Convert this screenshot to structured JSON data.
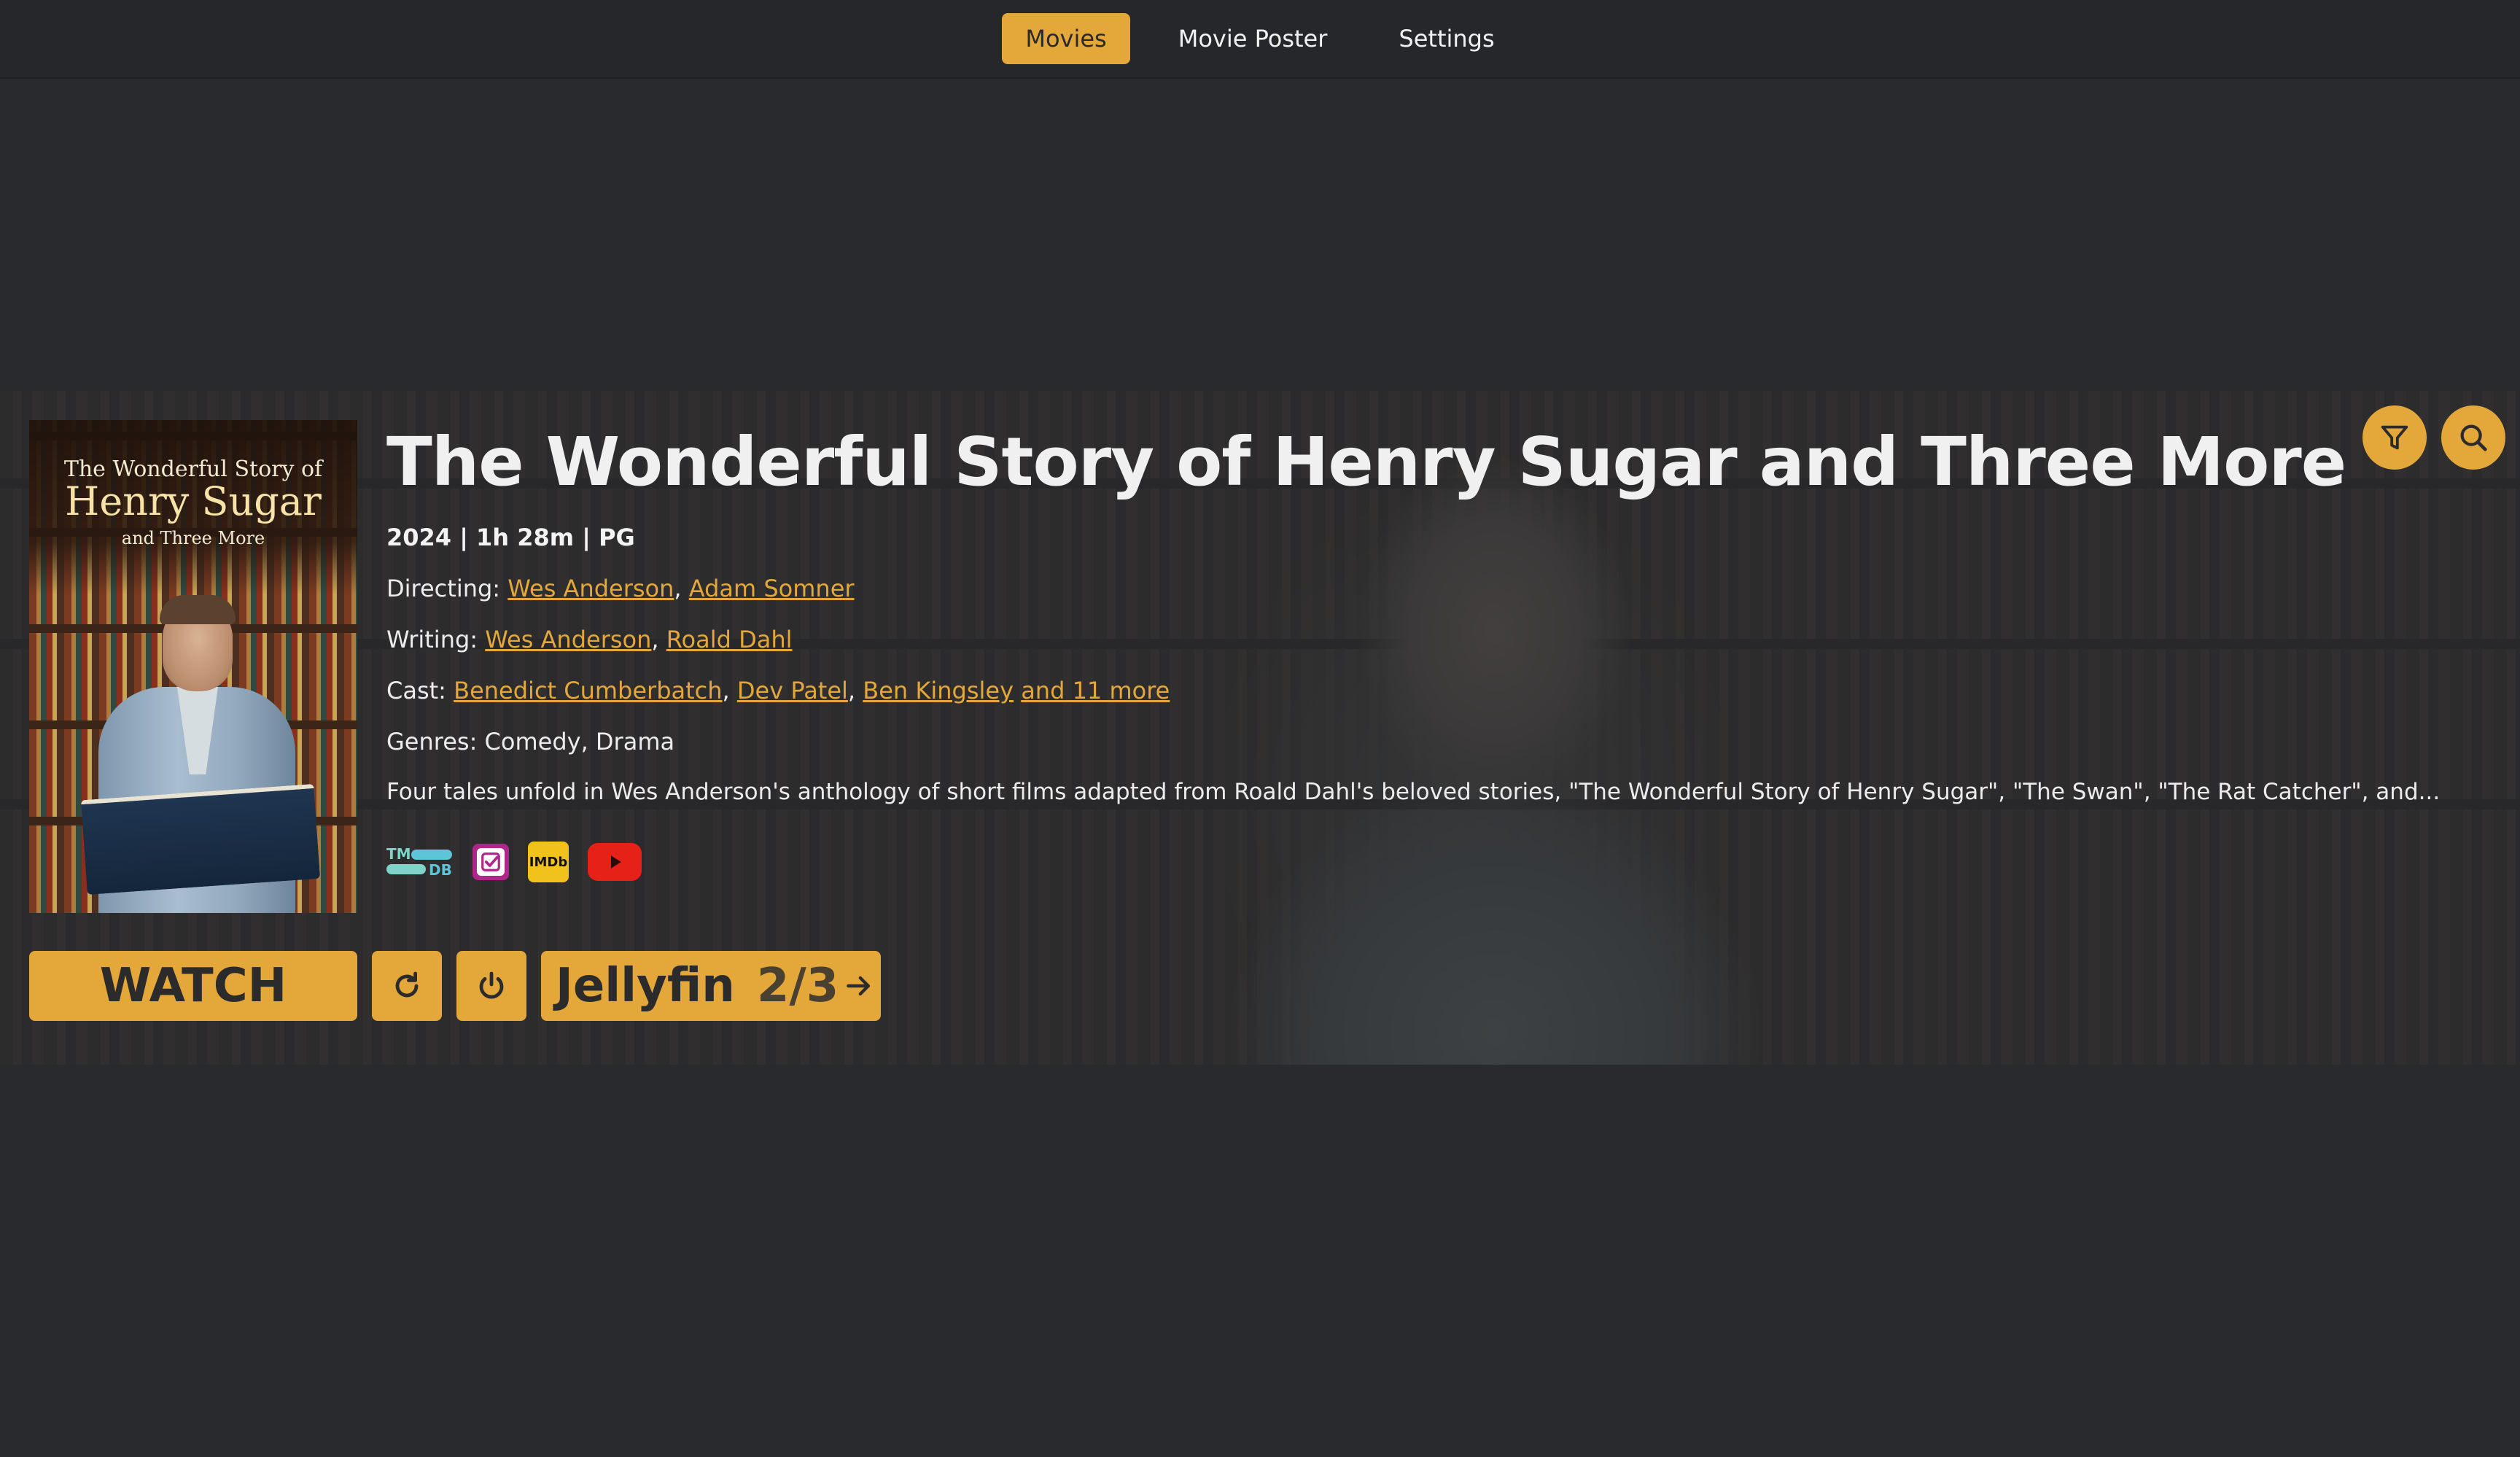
{
  "nav": {
    "tabs": [
      {
        "label": "Movies",
        "active": true
      },
      {
        "label": "Movie Poster",
        "active": false
      },
      {
        "label": "Settings",
        "active": false
      }
    ]
  },
  "poster": {
    "line1": "The Wonderful Story of",
    "line2": "Henry Sugar",
    "line3": "and Three More"
  },
  "movie": {
    "title": "The Wonderful Story of Henry Sugar and Three More",
    "meta": "2024 | 1h 28m | PG",
    "directing_label": "Directing:",
    "directors": [
      "Wes Anderson",
      "Adam Somner"
    ],
    "writing_label": "Writing:",
    "writers": [
      "Wes Anderson",
      "Roald Dahl"
    ],
    "cast_label": "Cast:",
    "cast": [
      "Benedict Cumberbatch",
      "Dev Patel",
      "Ben Kingsley"
    ],
    "cast_more": "and 11 more",
    "genres_label": "Genres:",
    "genres": "Comedy, Drama",
    "overview": "Four tales unfold in Wes Anderson's anthology of short films adapted from Roald Dahl's beloved stories, \"The Wonderful Story of Henry Sugar\", \"The Swan\", \"The Rat Catcher\", and..."
  },
  "links": {
    "tmdb_top": "TM",
    "tmdb_bottom": "DB",
    "imdb": "IMDb",
    "icons": [
      "tmdb-icon",
      "letterboxd-check-icon",
      "imdb-icon",
      "youtube-icon"
    ]
  },
  "actions": {
    "watch_label": "WATCH",
    "server_label": "Jellyfin",
    "server_count": "2/3"
  },
  "icons": {
    "filter": "filter-icon",
    "search": "search-icon",
    "refresh": "refresh-icon",
    "power": "power-icon",
    "arrow": "arrow-right-icon"
  },
  "colors": {
    "accent": "#e3a73a",
    "background": "#292a2e",
    "nav_background": "#26272b",
    "text": "#ececec"
  }
}
